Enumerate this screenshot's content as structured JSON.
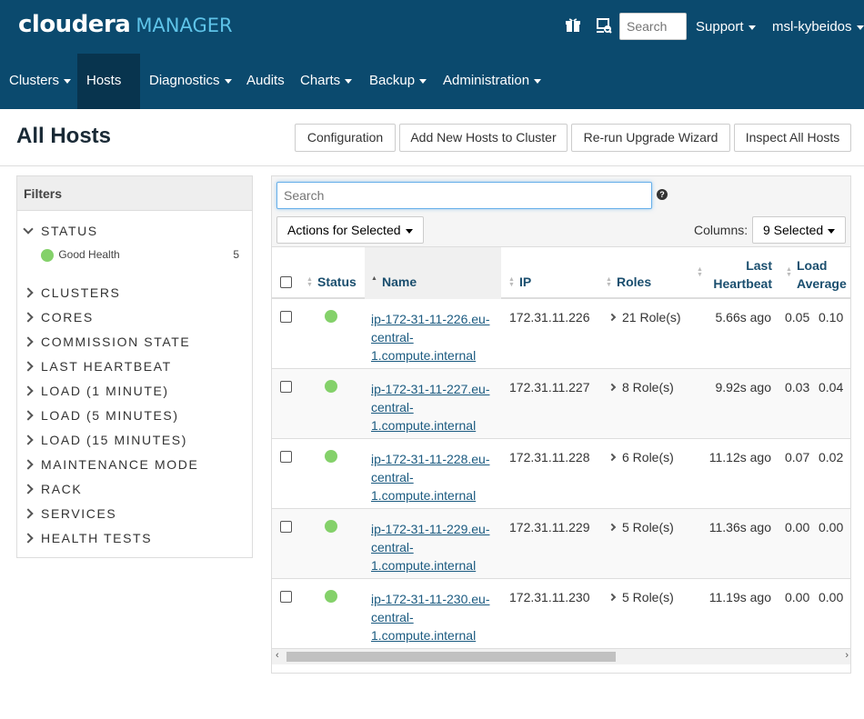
{
  "header": {
    "logo_brand": "cloudera",
    "logo_product": "MANAGER",
    "search_placeholder": "Search",
    "support_label": "Support",
    "user_label": "msl-kybeidos",
    "icons": [
      "gift-icon",
      "parcel-icon"
    ]
  },
  "nav": {
    "items": [
      {
        "label": "Clusters",
        "dropdown": true
      },
      {
        "label": "Hosts",
        "dropdown": true,
        "active": true
      },
      {
        "label": "Diagnostics",
        "dropdown": true
      },
      {
        "label": "Audits",
        "dropdown": false
      },
      {
        "label": "Charts",
        "dropdown": true
      },
      {
        "label": "Backup",
        "dropdown": true
      },
      {
        "label": "Administration",
        "dropdown": true
      }
    ]
  },
  "page": {
    "title": "All Hosts",
    "buttons": [
      "Configuration",
      "Add New Hosts to Cluster",
      "Re-run Upgrade Wizard",
      "Inspect All Hosts"
    ]
  },
  "filters": {
    "title": "Filters",
    "status_label": "STATUS",
    "good_health_label": "Good Health",
    "good_health_count": "5",
    "groups": [
      "CLUSTERS",
      "CORES",
      "COMMISSION STATE",
      "LAST HEARTBEAT",
      "LOAD (1 MINUTE)",
      "LOAD (5 MINUTES)",
      "LOAD (15 MINUTES)",
      "MAINTENANCE MODE",
      "RACK",
      "SERVICES",
      "HEALTH TESTS"
    ]
  },
  "table": {
    "search_placeholder": "Search",
    "actions_label": "Actions for Selected",
    "columns_label": "Columns:",
    "columns_value": "9 Selected",
    "headers": {
      "status": "Status",
      "name": "Name",
      "ip": "IP",
      "roles": "Roles",
      "heartbeat_line1": "Last",
      "heartbeat_line2": "Heartbeat",
      "load_line1": "Load",
      "load_line2": "Average"
    },
    "rows": [
      {
        "name_line1": "ip-172-31-11-226.eu-",
        "name_line2": "central-",
        "name_line3": "1.compute.internal",
        "ip": "172.31.11.226",
        "roles": "21 Role(s)",
        "heartbeat": "5.66s ago",
        "load1": "0.05",
        "load5": "0.10"
      },
      {
        "name_line1": "ip-172-31-11-227.eu-",
        "name_line2": "central-",
        "name_line3": "1.compute.internal",
        "ip": "172.31.11.227",
        "roles": "8 Role(s)",
        "heartbeat": "9.92s ago",
        "load1": "0.03",
        "load5": "0.04"
      },
      {
        "name_line1": "ip-172-31-11-228.eu-",
        "name_line2": "central-",
        "name_line3": "1.compute.internal",
        "ip": "172.31.11.228",
        "roles": "6 Role(s)",
        "heartbeat": "11.12s ago",
        "load1": "0.07",
        "load5": "0.02"
      },
      {
        "name_line1": "ip-172-31-11-229.eu-",
        "name_line2": "central-",
        "name_line3": "1.compute.internal",
        "ip": "172.31.11.229",
        "roles": "5 Role(s)",
        "heartbeat": "11.36s ago",
        "load1": "0.00",
        "load5": "0.00"
      },
      {
        "name_line1": "ip-172-31-11-230.eu-",
        "name_line2": "central-",
        "name_line3": "1.compute.internal",
        "ip": "172.31.11.230",
        "roles": "5 Role(s)",
        "heartbeat": "11.19s ago",
        "load1": "0.00",
        "load5": "0.00"
      }
    ]
  },
  "colors": {
    "header_bg": "#0b4a6e",
    "nav_active_bg": "#08344e",
    "logo_accent": "#5ec3e8",
    "good_health": "#84d16a",
    "link": "#1a5a80"
  }
}
